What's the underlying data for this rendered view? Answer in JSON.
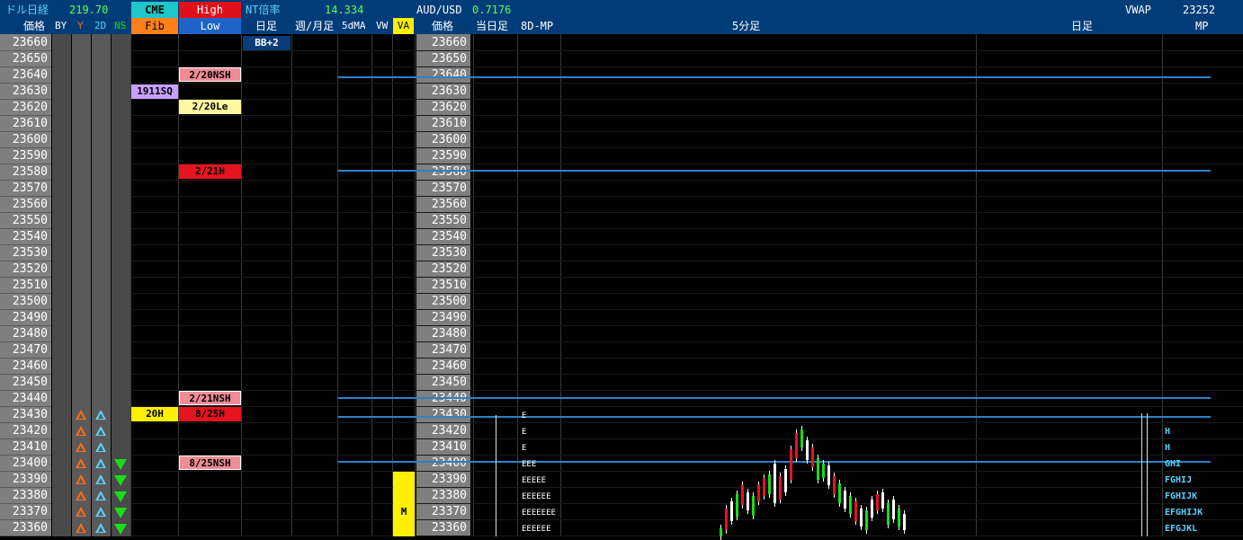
{
  "header": {
    "dollar_nikkei_label": "ドル日経",
    "dollar_nikkei_value": "219.70",
    "cme_label": "CME",
    "high_label": "High",
    "nt_ratio_label": "NT倍率",
    "nt_ratio_value": "14.334",
    "audusd_label": "AUD/USD",
    "audusd_value": "0.7176",
    "vwap_label": "VWAP",
    "vwap_value": "23252",
    "price_label": "価格",
    "by_label": "BY",
    "y_label": "Y",
    "d2_label": "2D",
    "ns_label": "NS",
    "fib_label": "Fib",
    "low_label": "Low",
    "daily_label": "日足",
    "week_month_label": "週/月足",
    "ma5_label": "5dMA",
    "vw_label": "VW",
    "va_label": "VA",
    "price_label_mid": "価格",
    "today_label": "当日足",
    "mp8d_label": "8D-MP",
    "min5_label": "5分足",
    "daily_right_label": "日足",
    "mp_label": "MP"
  },
  "prices": [
    "23660",
    "23650",
    "23640",
    "23630",
    "23620",
    "23610",
    "23600",
    "23590",
    "23580",
    "23570",
    "23560",
    "23550",
    "23540",
    "23530",
    "23520",
    "23510",
    "23500",
    "23490",
    "23480",
    "23470",
    "23460",
    "23450",
    "23440",
    "23430",
    "23420",
    "23410",
    "23400",
    "23390",
    "23380",
    "23370",
    "23360"
  ],
  "tags": {
    "bb2": "BB+2",
    "nsh_220": "2/20NSH",
    "sq_1911": "1911SQ",
    "le_220": "2/20Le",
    "h_221": "2/21H",
    "nsh_221": "2/21NSH",
    "h_20": "20H",
    "h_825": "8/25H",
    "nsh_825": "8/25NSH",
    "va_marker": "M"
  },
  "mp_rows": {
    "r23430": "E",
    "r23420": "E",
    "r23410": "E",
    "r23400": "EEE",
    "r23390": "EEEEE",
    "r23380": "EEEEEE",
    "r23370": "EEEEEEE",
    "r23360": "EEEEEE"
  },
  "mp_right": {
    "r23420": "H",
    "r23410": "H",
    "r23400": "GHI",
    "r23390": "FGHIJ",
    "r23380": "FGHIJK",
    "r23370": "EFGHIJK",
    "r23360": "EFGJKL"
  },
  "colors": {
    "header_bg": "#003c78",
    "level_line": "#2a82c8",
    "price_col": "#7f7f7f",
    "up_candle": "#1adc1a",
    "down_candle": "#e6141e"
  },
  "icons": [
    "triangle-up-orange-icon",
    "triangle-up-cyan-icon",
    "triangle-down-green-icon"
  ]
}
